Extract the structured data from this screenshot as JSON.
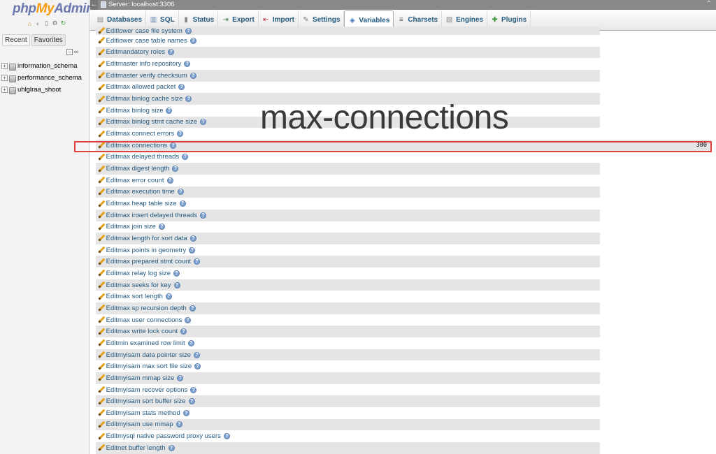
{
  "logo": {
    "php": "php",
    "my": "My",
    "admin": "Admin"
  },
  "left": {
    "tabs": [
      "Recent",
      "Favorites"
    ],
    "databases": [
      "information_schema",
      "performance_schema",
      "uhlglraa_shoot"
    ]
  },
  "server_bar": {
    "label": "Server: localhost:3306"
  },
  "topmenu": {
    "tabs": [
      "Databases",
      "SQL",
      "Status",
      "Export",
      "Import",
      "Settings",
      "Variables",
      "Charsets",
      "Engines",
      "Plugins"
    ],
    "active": "Variables"
  },
  "variables": {
    "edit_label": "Edit",
    "partial_top": "lower case file system",
    "rows": [
      {
        "name": "lower case table names",
        "value": ""
      },
      {
        "name": "mandatory roles",
        "value": ""
      },
      {
        "name": "master info repository",
        "value": ""
      },
      {
        "name": "master verify checksum",
        "value": ""
      },
      {
        "name": "max allowed packet",
        "value": ""
      },
      {
        "name": "max binlog cache size",
        "value": ""
      },
      {
        "name": "max binlog size",
        "value": ""
      },
      {
        "name": "max binlog stmt cache size",
        "value": ""
      },
      {
        "name": "max connect errors",
        "value": ""
      },
      {
        "name": "max connections",
        "value": "300",
        "highlight": true
      },
      {
        "name": "max delayed threads",
        "value": ""
      },
      {
        "name": "max digest length",
        "value": ""
      },
      {
        "name": "max error count",
        "value": ""
      },
      {
        "name": "max execution time",
        "value": ""
      },
      {
        "name": "max heap table size",
        "value": ""
      },
      {
        "name": "max insert delayed threads",
        "value": ""
      },
      {
        "name": "max join size",
        "value": ""
      },
      {
        "name": "max length for sort data",
        "value": ""
      },
      {
        "name": "max points in geometry",
        "value": ""
      },
      {
        "name": "max prepared stmt count",
        "value": ""
      },
      {
        "name": "max relay log size",
        "value": ""
      },
      {
        "name": "max seeks for key",
        "value": ""
      },
      {
        "name": "max sort length",
        "value": ""
      },
      {
        "name": "max sp recursion depth",
        "value": ""
      },
      {
        "name": "max user connections",
        "value": ""
      },
      {
        "name": "max write lock count",
        "value": ""
      },
      {
        "name": "min examined row limit",
        "value": ""
      },
      {
        "name": "myisam data pointer size",
        "value": ""
      },
      {
        "name": "myisam max sort file size",
        "value": ""
      },
      {
        "name": "myisam mmap size",
        "value": ""
      },
      {
        "name": "myisam recover options",
        "value": ""
      },
      {
        "name": "myisam sort buffer size",
        "value": ""
      },
      {
        "name": "myisam stats method",
        "value": ""
      },
      {
        "name": "myisam use mmap",
        "value": ""
      },
      {
        "name": "mysql native password proxy users",
        "value": ""
      },
      {
        "name": "net buffer length",
        "value": ""
      }
    ]
  },
  "caption": "max-connections",
  "colors": {
    "highlight_border": "#e0413d",
    "link": "#235a81",
    "row_alt": "#e5e5e5"
  }
}
